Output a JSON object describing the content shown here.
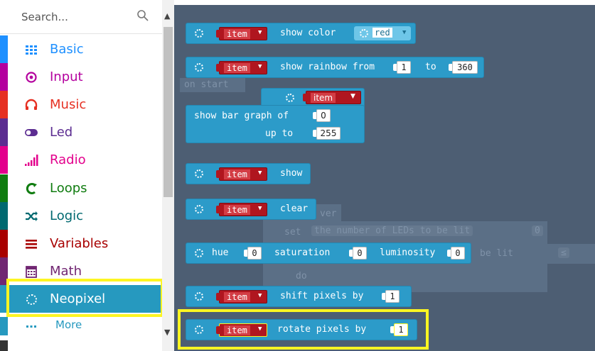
{
  "search": {
    "placeholder": "Search..."
  },
  "toolbox": {
    "categories": [
      {
        "label": "Basic",
        "color": "#1e90ff",
        "icon": "grid-icon"
      },
      {
        "label": "Input",
        "color": "#b4009e",
        "icon": "target-icon"
      },
      {
        "label": "Music",
        "color": "#e63022",
        "icon": "headphones-icon"
      },
      {
        "label": "Led",
        "color": "#5c2d91",
        "icon": "toggle-icon"
      },
      {
        "label": "Radio",
        "color": "#e3008c",
        "icon": "signal-bars-icon"
      },
      {
        "label": "Loops",
        "color": "#107c10",
        "icon": "loop-arrow-icon"
      },
      {
        "label": "Logic",
        "color": "#006970",
        "icon": "shuffle-icon"
      },
      {
        "label": "Variables",
        "color": "#a80000",
        "icon": "list-lines-icon"
      },
      {
        "label": "Math",
        "color": "#712672",
        "icon": "calculator-icon"
      },
      {
        "label": "Neopixel",
        "color": "#2699bf",
        "icon": "neopixel-ring-icon",
        "selected": true
      },
      {
        "label": "More",
        "color": "#2699bf",
        "icon": "ellipsis-icon"
      }
    ]
  },
  "workspace": {
    "ghost": {
      "on_start": "on start",
      "forever": "ver",
      "set": "set",
      "var_name": "the number of LEDs to be lit",
      "var_tail": "be lit",
      "zero": "0",
      "do": "do",
      "op": "≤"
    },
    "blocks": {
      "show_color": {
        "item": "item",
        "text": "show color",
        "color_value": "red"
      },
      "show_rainbow": {
        "item": "item",
        "text": "show rainbow from",
        "from": "1",
        "to_label": "to",
        "to": "360"
      },
      "bar_graph": {
        "item": "item",
        "text_of": "show bar graph of",
        "value": "0",
        "up_to_label": "up to",
        "up_to": "255"
      },
      "show": {
        "item": "item",
        "text": "show"
      },
      "clear": {
        "item": "item",
        "text": "clear"
      },
      "hsl": {
        "hue_label": "hue",
        "hue": "0",
        "saturation_label": "saturation",
        "saturation": "0",
        "luminosity_label": "luminosity",
        "luminosity": "0"
      },
      "shift": {
        "item": "item",
        "text": "shift pixels by",
        "value": "1"
      },
      "rotate": {
        "item": "item",
        "text": "rotate pixels by",
        "value": "1"
      }
    }
  },
  "colors": {
    "neopixel_block": "#2c9bc9",
    "variable_block": "#b0161f",
    "workspace_bg": "#4d5e73",
    "highlight": "#fdf522"
  }
}
